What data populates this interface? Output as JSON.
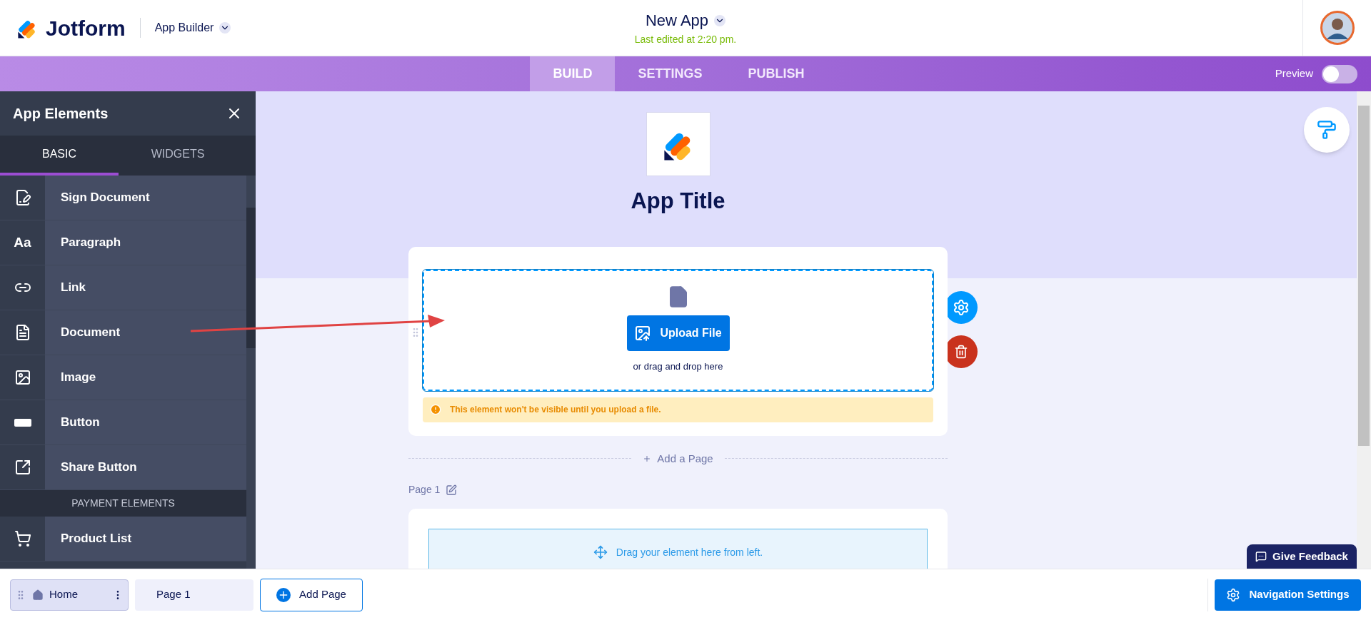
{
  "header": {
    "brand": "Jotform",
    "product": "App Builder",
    "app_name": "New App",
    "last_edited": "Last edited at 2:20 pm."
  },
  "nav": {
    "tabs": [
      {
        "label": "BUILD",
        "selected": true
      },
      {
        "label": "SETTINGS",
        "selected": false
      },
      {
        "label": "PUBLISH",
        "selected": false
      }
    ],
    "preview": {
      "label": "Preview",
      "on": false
    }
  },
  "sidebar": {
    "title": "App Elements",
    "tabs": [
      {
        "label": "BASIC",
        "selected": true
      },
      {
        "label": "WIDGETS",
        "selected": false
      }
    ],
    "items": [
      {
        "kind": "element",
        "label": "Sign Document"
      },
      {
        "kind": "element",
        "glyph": "Aa",
        "label": "Paragraph"
      },
      {
        "kind": "element",
        "label": "Link"
      },
      {
        "kind": "element",
        "label": "Document"
      },
      {
        "kind": "element",
        "label": "Image"
      },
      {
        "kind": "element",
        "label": "Button"
      },
      {
        "kind": "element",
        "label": "Share Button"
      },
      {
        "kind": "section",
        "label": "PAYMENT ELEMENTS"
      },
      {
        "kind": "element",
        "label": "Product List"
      }
    ]
  },
  "canvas": {
    "app_title": "App Title",
    "upload": {
      "button": "Upload File",
      "hint": "or drag and drop here",
      "warning": "This element won't be visible until you upload a file."
    },
    "add_page": "Add a Page",
    "page_label": "Page 1",
    "drop_hint": "Drag your element here from left."
  },
  "feedback": "Give Feedback",
  "bottom": {
    "pages": [
      {
        "label": "Home",
        "selected": true,
        "home": true
      },
      {
        "label": "Page 1",
        "selected": false,
        "home": false
      }
    ],
    "add_page": "Add Page",
    "nav_settings": "Navigation Settings"
  }
}
